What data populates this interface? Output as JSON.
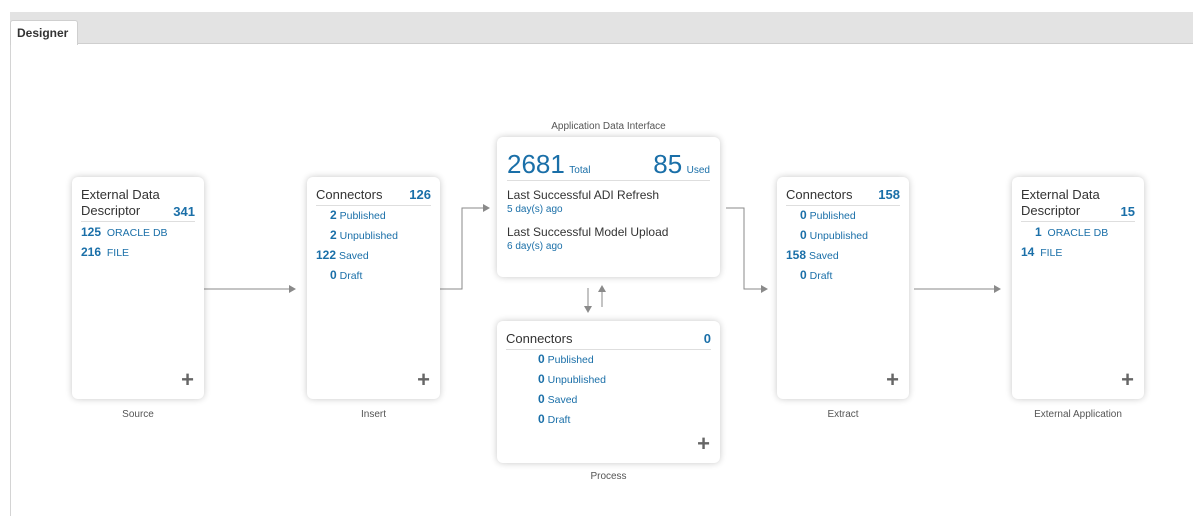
{
  "tab": {
    "label": "Designer"
  },
  "source": {
    "title": "External Data Descriptor",
    "count": "341",
    "rows": [
      {
        "num": "125",
        "text": "ORACLE DB"
      },
      {
        "num": "216",
        "text": "FILE"
      }
    ],
    "label": "Source"
  },
  "insert": {
    "title": "Connectors",
    "count": "126",
    "rows": [
      {
        "num": "2",
        "text": "Published"
      },
      {
        "num": "2",
        "text": "Unpublished"
      },
      {
        "num": "122",
        "text": "Saved"
      },
      {
        "num": "0",
        "text": "Draft"
      }
    ],
    "label": "Insert"
  },
  "adi": {
    "caption": "Application Data Interface",
    "total_num": "2681",
    "total_label": "Total",
    "used_num": "85",
    "used_label": "Used",
    "refresh_title": "Last Successful ADI Refresh",
    "refresh_ago": "5 day(s) ago",
    "upload_title": "Last Successful Model Upload",
    "upload_ago": "6 day(s) ago"
  },
  "process": {
    "title": "Connectors",
    "count": "0",
    "rows": [
      {
        "num": "0",
        "text": "Published"
      },
      {
        "num": "0",
        "text": "Unpublished"
      },
      {
        "num": "0",
        "text": "Saved"
      },
      {
        "num": "0",
        "text": "Draft"
      }
    ],
    "label": "Process"
  },
  "extract": {
    "title": "Connectors",
    "count": "158",
    "rows": [
      {
        "num": "0",
        "text": "Published"
      },
      {
        "num": "0",
        "text": "Unpublished"
      },
      {
        "num": "158",
        "text": "Saved"
      },
      {
        "num": "0",
        "text": "Draft"
      }
    ],
    "label": "Extract"
  },
  "external": {
    "title": "External Data Descriptor",
    "count": "15",
    "rows": [
      {
        "num": "1",
        "text": "ORACLE DB"
      },
      {
        "num": "14",
        "text": "FILE"
      }
    ],
    "label": "External Application"
  },
  "plus_glyph": "+"
}
